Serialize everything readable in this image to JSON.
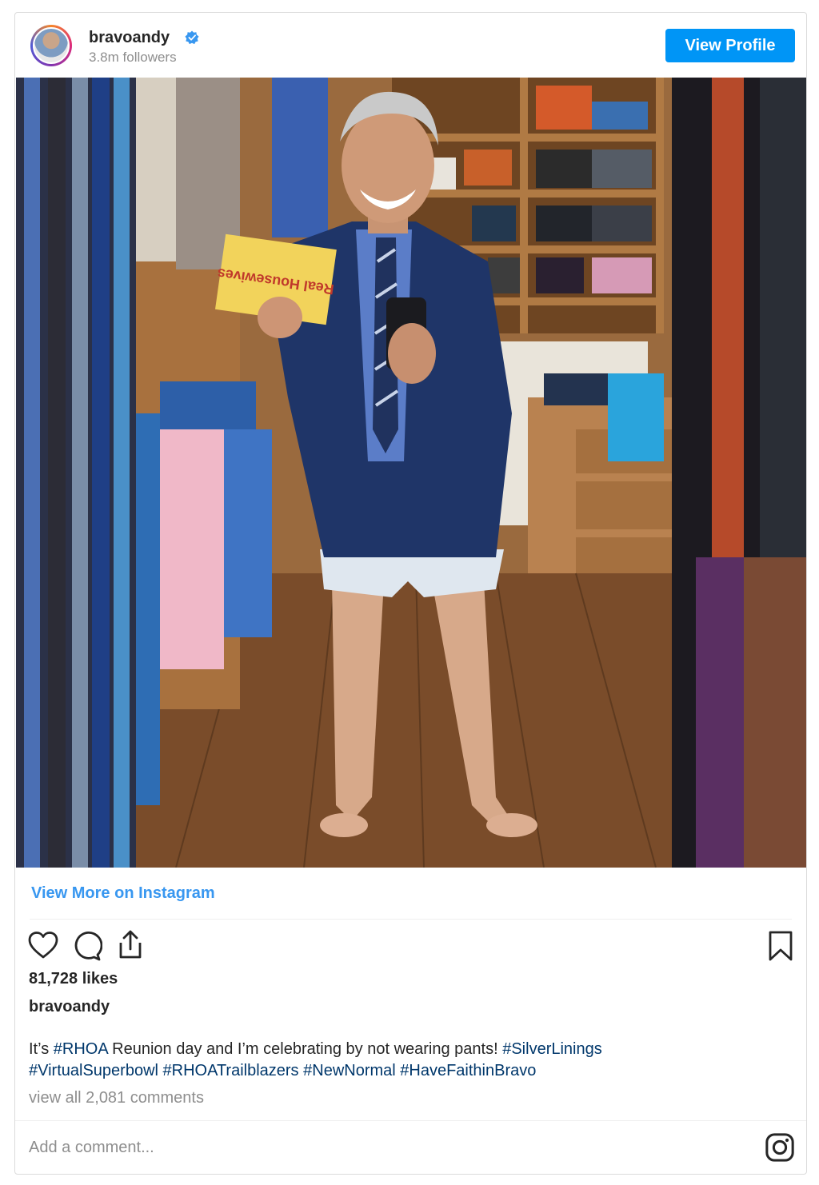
{
  "header": {
    "username": "bravoandy",
    "followers": "3.8m followers",
    "view_profile_label": "View Profile"
  },
  "photo": {
    "envelope_text": "Real Housewives"
  },
  "view_more_label": "View More on Instagram",
  "stats": {
    "likes": "81,728 likes"
  },
  "caption": {
    "username": "bravoandy",
    "line1_before": "It’s ",
    "line1_tag1": "#RHOA",
    "line1_middle": " Reunion day and I’m celebrating by not wearing pants! ",
    "line1_tag2": "#SilverLinings",
    "line2_tags": [
      "#VirtualSuperbowl",
      "#RHOATrailblazers",
      "#NewNormal",
      "#HaveFaithinBravo"
    ]
  },
  "comments_link": "view all 2,081 comments",
  "add_comment_placeholder": "Add a comment...",
  "colors": {
    "accent": "#0095f6",
    "link": "#3897f0",
    "hashtag": "#00376b",
    "muted": "#8e8e8e"
  },
  "icons": [
    "verified-badge-icon",
    "heart-icon",
    "comment-icon",
    "share-icon",
    "bookmark-icon",
    "instagram-icon"
  ]
}
